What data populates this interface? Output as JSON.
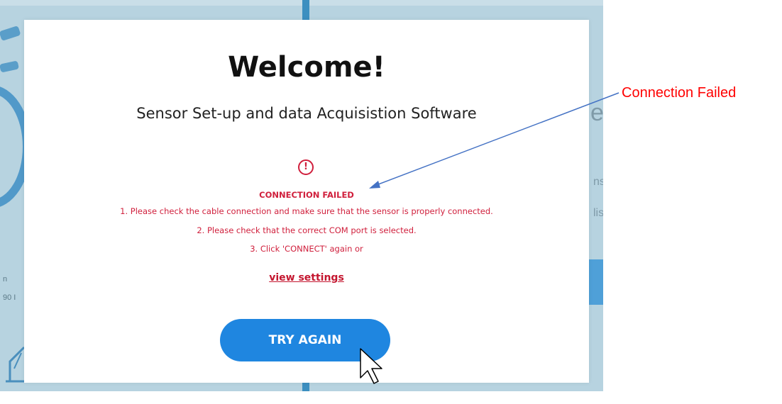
{
  "modal": {
    "title": "Welcome!",
    "subtitle": "Sensor Set-up and data Acquisistion Software",
    "alert_icon_glyph": "!",
    "error": {
      "title": "CONNECTION FAILED",
      "lines": [
        "1. Please check the cable connection and make sure that the sensor is properly connected.",
        "2. Please check that the correct COM port is selected.",
        "3. Click 'CONNECT' again or"
      ]
    },
    "view_settings_label": "view settings",
    "try_again_label": "TRY AGAIN"
  },
  "background": {
    "partial_text_1": "e",
    "partial_text_2": "ns",
    "partial_text_3": "lis",
    "partial_text_4": "90 I",
    "partial_text_5": "n"
  },
  "annotation": {
    "label": "Connection Failed"
  },
  "icons": {
    "alert": "exclamation-circle-icon",
    "cursor": "mouse-pointer-icon"
  },
  "colors": {
    "error_red": "#d01f3c",
    "button_blue": "#1f86e0",
    "annotation_red": "#ff0000",
    "arrow_blue": "#4472c4"
  }
}
